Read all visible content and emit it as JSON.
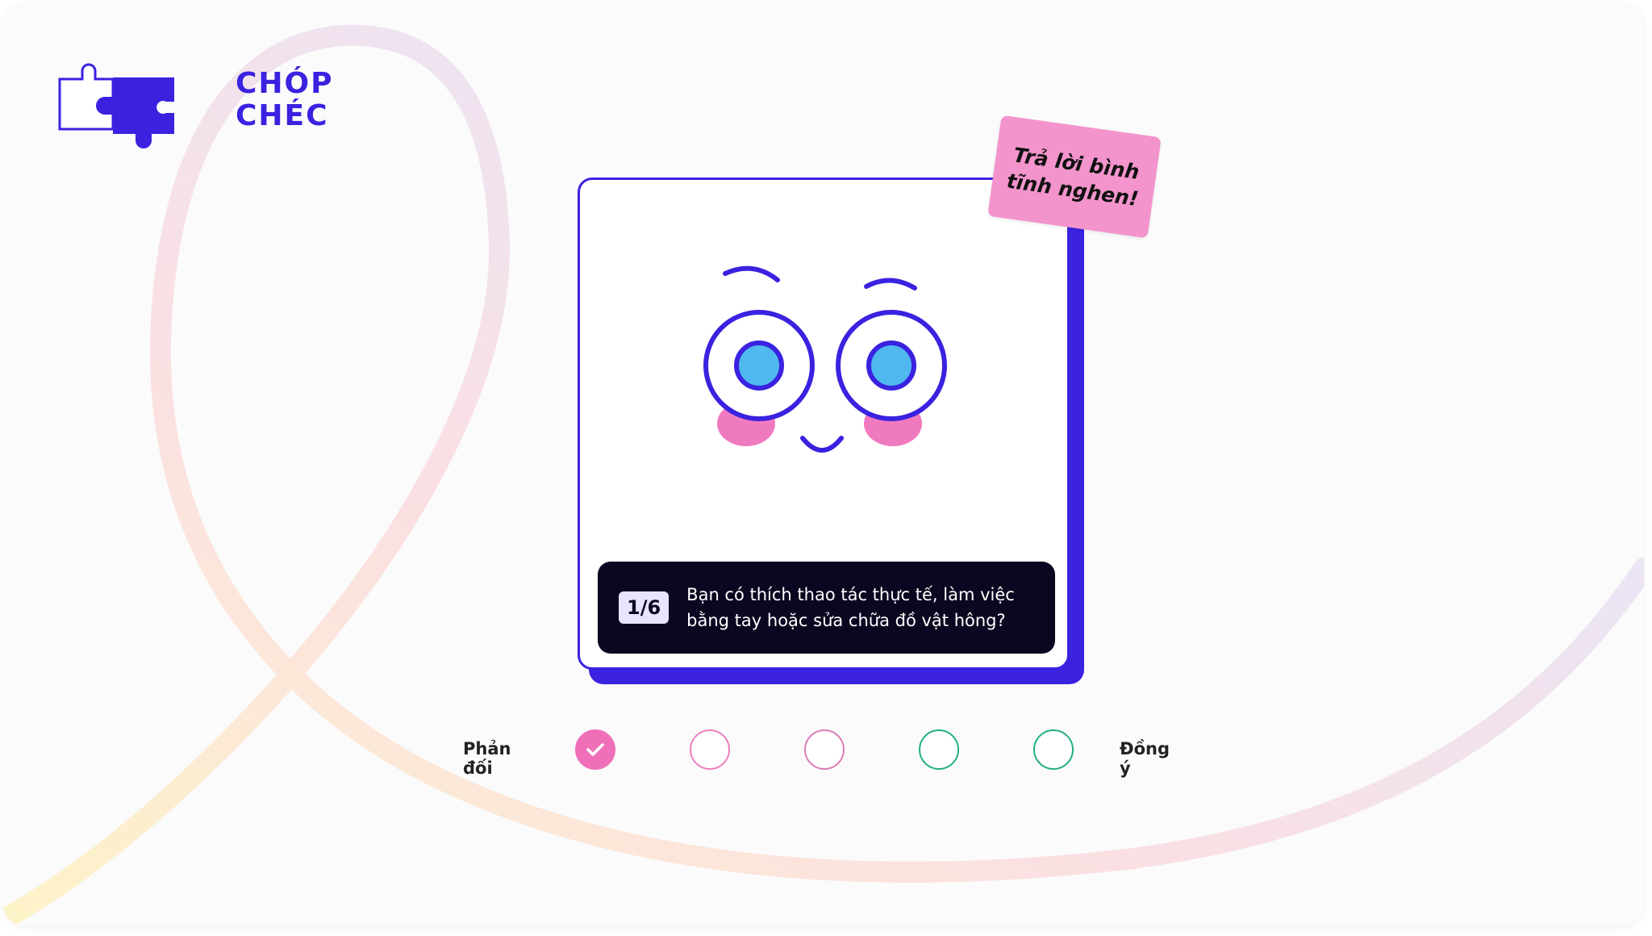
{
  "brand": {
    "line1": "CHÓP",
    "line2": "CHÉC",
    "color": "#3a22e0"
  },
  "sticker": {
    "line1": "Trả lời bình",
    "line2": "tĩnh nghen!",
    "color": "#f394cc"
  },
  "question": {
    "counter": "1/6",
    "text": "Bạn có thích thao tác thực tế, làm việc bằng tay hoặc sửa chữa đồ vật hông?"
  },
  "scale": {
    "left_label": "Phản đối",
    "right_label": "Đồng ý",
    "selected_index": 0,
    "options": [
      {
        "color": "#ef6fb8",
        "selected": true
      },
      {
        "color": "#ec7fbe",
        "selected": false
      },
      {
        "color": "#d97db7",
        "selected": false
      },
      {
        "color": "#22b07a",
        "selected": false
      },
      {
        "color": "#22b07a",
        "selected": false
      }
    ]
  },
  "icons": [
    "puzzle-logo-icon",
    "face-illustration",
    "check-icon"
  ]
}
